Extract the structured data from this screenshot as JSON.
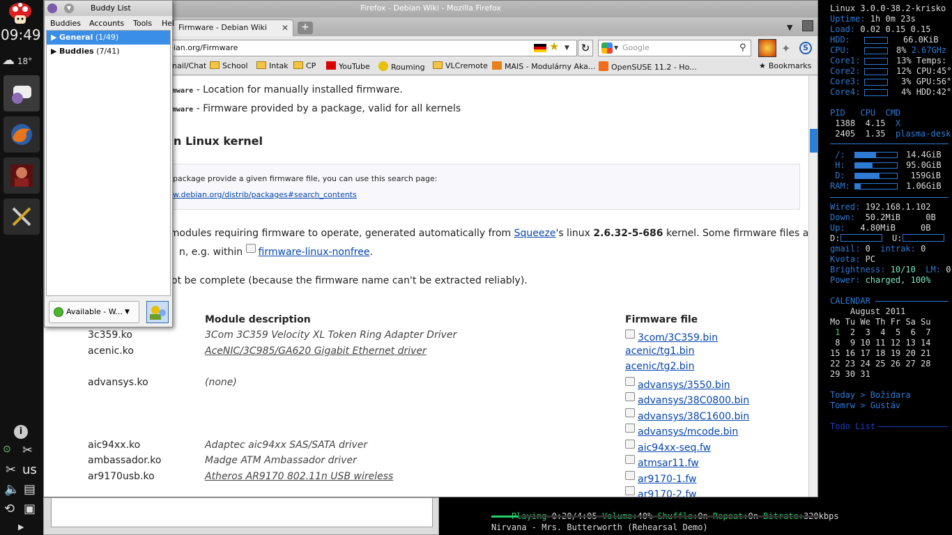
{
  "dock": {
    "time": "09:49",
    "weather_temp": "18°",
    "tray_lang": "us"
  },
  "firefox": {
    "title": "Firefox - Debian Wiki - Mozilla Firefox",
    "tab_label": "Firmware - Debian Wiki",
    "url": "bian.org/Firmware",
    "search_placeholder": "Google",
    "bookmarks": [
      "nail/Chat",
      "School",
      "Intak",
      "CP",
      "YouTube",
      "Rouming",
      "VLCremote",
      "MAIS - Modulárny Aka...",
      "OpenSUSE 11.2 - Ho...",
      "Bookmarks"
    ]
  },
  "page": {
    "line1_code": "rmware",
    "line1_text": " - Location for manually installed firmware.",
    "line2_code": "rmware",
    "line2_text": " - Firmware provided by a package, valid for all kernels",
    "heading": "n Linux kernel",
    "info_text": "package provide a given firmware file, you can use this search page:",
    "info_link": "w.debian.org/distrib/packages#search_contents",
    "para1_a": "x modules requiring firmware to operate, generated automatically from ",
    "para1_link": "Squeeze",
    "para1_b": "'s linux ",
    "para1_bold": "2.6.32-5-686",
    "para1_c": " kernel. Some firmware files are",
    "para2_a": "n, e.g. within ",
    "para2_link": "firmware-linux-nonfree",
    "para2_b": ".",
    "para3": "ot be complete (because the firmware name can't be extracted reliably).",
    "col_desc": "Module description",
    "col_fw": "Firmware file",
    "rows": [
      {
        "module": "3c359.ko",
        "desc": "3Com 3C359 Velocity XL Token Ring Adapter Driver",
        "fw": [
          "3com/3C359.bin"
        ]
      },
      {
        "module": "acenic.ko",
        "desc": "AceNIC/3C985/GA620 Gigabit Ethernet driver",
        "fw": [
          "acenic/tg1.bin",
          "acenic/tg2.bin"
        ]
      },
      {
        "module": "advansys.ko",
        "desc": "(none)",
        "fw": [
          "advansys/3550.bin",
          "advansys/38C0800.bin",
          "advansys/38C1600.bin",
          "advansys/mcode.bin"
        ]
      },
      {
        "module": "aic94xx.ko",
        "desc": "Adaptec aic94xx SAS/SATA driver",
        "fw": [
          "aic94xx-seq.fw"
        ]
      },
      {
        "module": "ambassador.ko",
        "desc": "Madge ATM Ambassador driver",
        "fw": [
          "atmsar11.fw"
        ]
      },
      {
        "module": "ar9170usb.ko",
        "desc": "Atheros AR9170 802.11n USB wireless",
        "fw": [
          "ar9170-1.fw",
          "ar9170-2.fw"
        ]
      }
    ]
  },
  "buddy": {
    "title": "Buddy List",
    "menu": [
      "Buddies",
      "Accounts",
      "Tools",
      "Hel"
    ],
    "group1": "General",
    "group1_count": "(1/49)",
    "group2": "Buddies",
    "group2_count": "(7/41)",
    "status": "Available - W..."
  },
  "conky": {
    "l_linux": "Linux 3.0.0-38.2-krisko",
    "l_uptime_k": "Uptime:",
    "l_uptime_v": " 1h 0m 23s",
    "l_load_k": "Load:",
    "l_load_v": " 0.02 0.15 0.15",
    "l_hdd_k": "HDD:",
    "l_hdd_v": "66.0KiB",
    "l_cpu_k": "CPU:",
    "l_cpu_v": "8%",
    "l_cpu_f": "2.67GHz",
    "core1_k": "Core1:",
    "core1_v": "13%",
    "temps": "Temps:",
    "core2_k": "Core2:",
    "core2_v": "12%",
    "cpu_temp": "CPU:45°",
    "core3_k": "Core3:",
    "core3_v": "3%",
    "gpu_temp": "GPU:56°",
    "core4_k": "Core4:",
    "core4_v": "4%",
    "hdd_temp": "HDD:42°",
    "proc_head": "PID   CPU  CMD",
    "proc1_a": " 1388  4.15  ",
    "proc1_b": "X",
    "proc2_a": " 2405  1.35  ",
    "proc2_b": "plasma-desk",
    "fs": [
      {
        "k": " /:",
        "v": "14.4GiB",
        "fill": 0.5
      },
      {
        "k": " H:",
        "v": "95.0GiB",
        "fill": 0.42
      },
      {
        "k": " D:",
        "v": "159GiB",
        "fill": 0.58
      },
      {
        "k": "RAM:",
        "v": "1.06GiB",
        "fill": 0.14
      }
    ],
    "wired_k": "Wired:",
    "wired_v": " 192.168.1.102",
    "down_k": "Down:",
    "down_v": "  50.2MiB     0B",
    "up_k": "Up:",
    "up_v": "   4.80MiB     0B",
    "dl": "D:",
    "ul": "U:",
    "gmail_k": "gmail:",
    "gmail_v": " 0",
    "intrak_k": "  intrak:",
    "intrak_v": " 0",
    "kvota_k": "Kvota:",
    "kvota_v": " PC",
    "bright_k": "Brightness:",
    "bright_v": " 10/10",
    "lm_k": "  LM:",
    "lm_v": " 0",
    "power_k": "Power:",
    "power_v": " charged, 100%",
    "cal_head": "CALENDAR",
    "cal_month": "    August 2011",
    "cal_days": "Mo Tu We Th Fr Sa Su",
    "cal_w1a": " ",
    "cal_w1_today": "1",
    "cal_w1b": "  2  3  4  5  6  7",
    "cal_w2": " 8  9 10 11 12 13 14",
    "cal_w3": "15 16 17 18 19 20 21",
    "cal_w4": "22 23 24 25 26 27 28",
    "cal_w5": "29 30 31",
    "today": "Today > Božidara",
    "tomrw": "Tomrw > Gustáv",
    "todo": "Todo List"
  },
  "music": {
    "playing_k": "Playing",
    "playing_v": " 0:20/4:05",
    "volume_k": " Volume:",
    "volume_v": "40%",
    "shuffle_k": " Shuffle:",
    "shuffle_v": "On",
    "repeat_k": " Repeat:",
    "repeat_v": "On",
    "bitrate_k": " Bitrate:",
    "bitrate_v": "320kbps",
    "track": "Nirvana - Mrs. Butterworth (Rehearsal Demo)",
    "progress": 0.082
  }
}
